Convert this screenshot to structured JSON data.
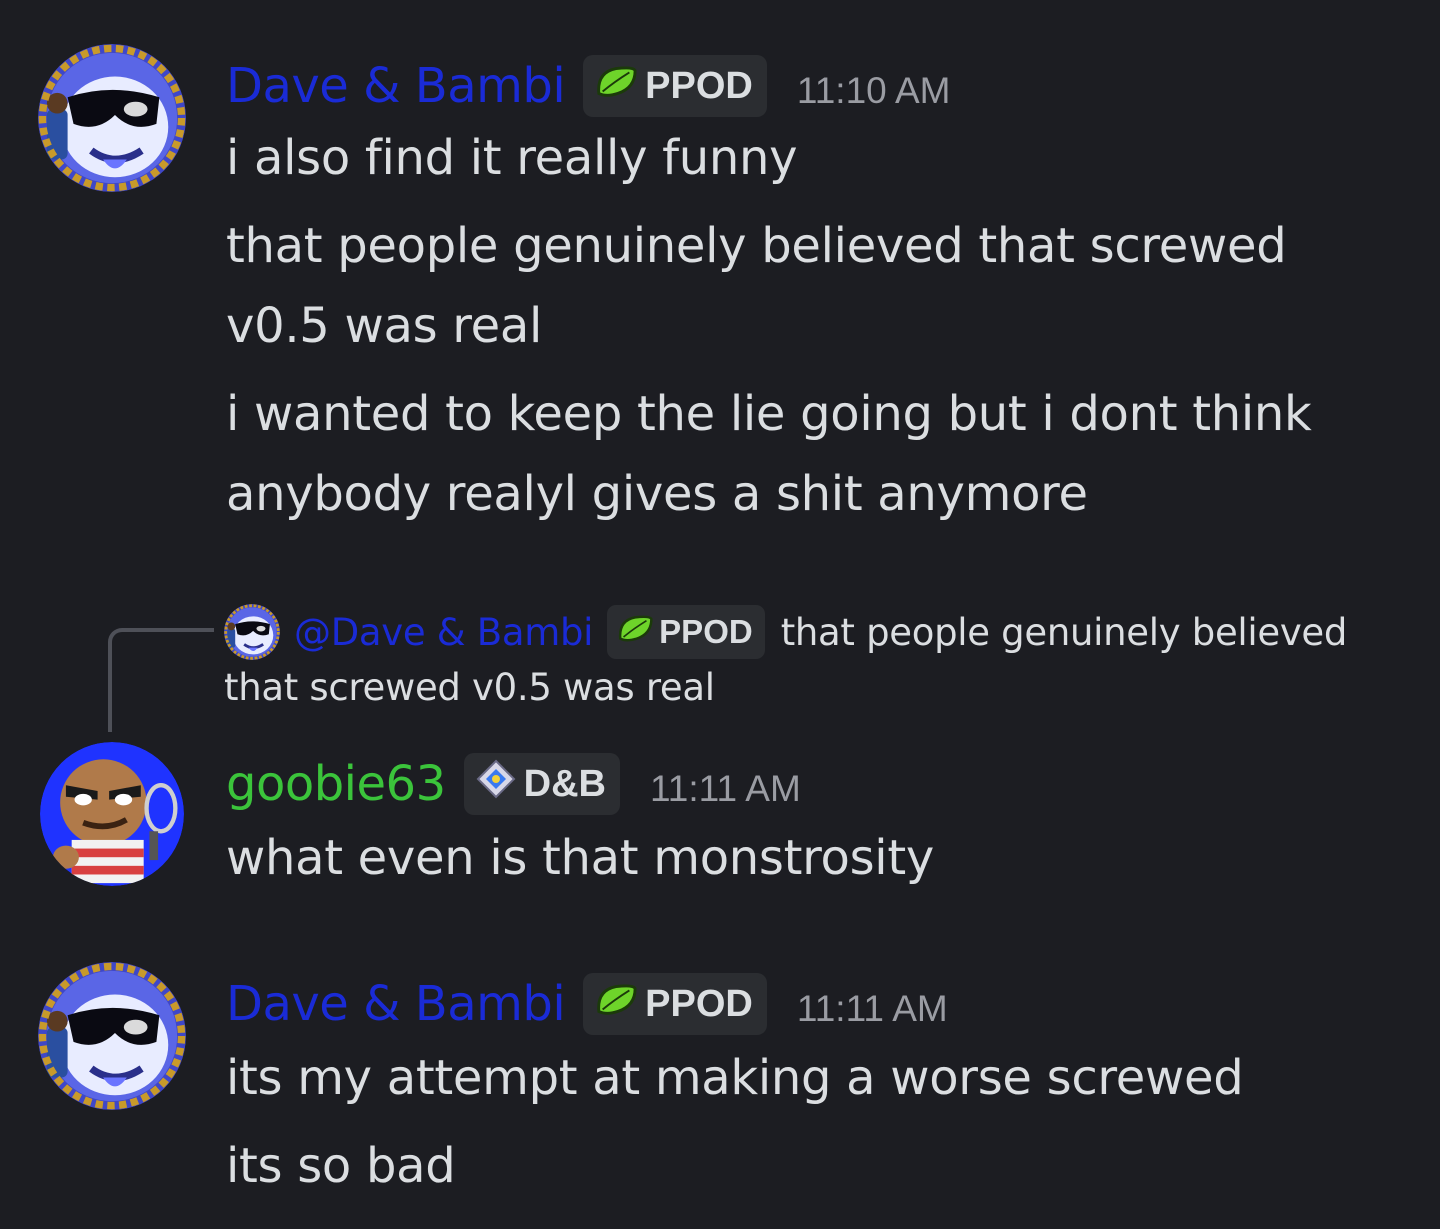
{
  "colors": {
    "background": "#1c1d22",
    "dave_bambi_name": "#1a2bd6",
    "goobie_name": "#3bc43b",
    "tag_background": "#2b2d31",
    "timestamp": "#9a9ca3"
  },
  "messages": [
    {
      "author": "Dave & Bambi",
      "avatar": "dave-bambi-avatar",
      "tag": "PPOD",
      "tag_icon": "leaf-icon",
      "time": "11:10 AM",
      "lines": [
        "i also find it really funny",
        "that people genuinely believed that screwed",
        "v0.5 was real",
        "i wanted to keep the lie going but i dont think",
        "anybody realyl gives a shit anymore"
      ]
    },
    {
      "reply": {
        "mention": "@Dave & Bambi",
        "tag": "PPOD",
        "tag_icon": "leaf-icon",
        "text_line1": "that people genuinely believed",
        "text_line2": "that screwed v0.5 was real"
      },
      "author": "goobie63",
      "avatar": "goobie-avatar",
      "tag": "D&B",
      "tag_icon": "diamond-icon",
      "time": "11:11 AM",
      "lines": [
        "what even is that monstrosity"
      ]
    },
    {
      "author": "Dave & Bambi",
      "avatar": "dave-bambi-avatar",
      "tag": "PPOD",
      "tag_icon": "leaf-icon",
      "time": "11:11 AM",
      "lines": [
        "its my attempt at making a worse screwed",
        "its so bad"
      ]
    }
  ]
}
